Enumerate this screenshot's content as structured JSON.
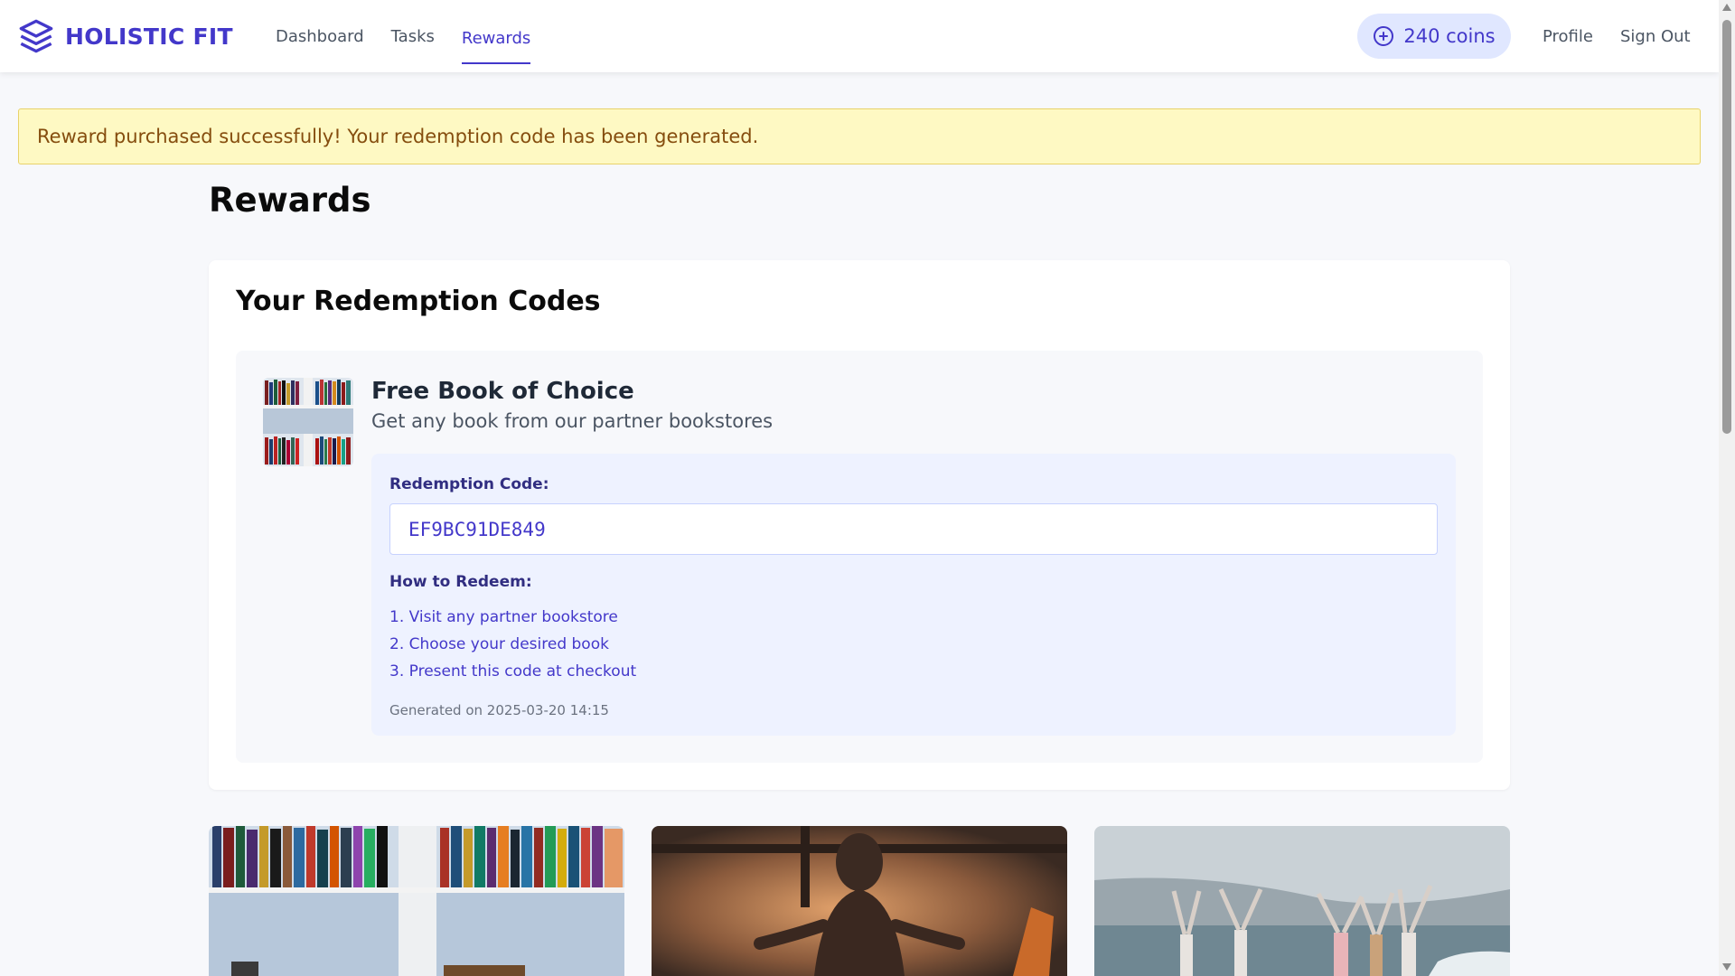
{
  "nav": {
    "brand": "HOLISTIC FIT",
    "links": [
      {
        "label": "Dashboard"
      },
      {
        "label": "Tasks"
      },
      {
        "label": "Rewards",
        "active": true
      }
    ],
    "coins": "240 coins",
    "profile": "Profile",
    "sign_out": "Sign Out"
  },
  "alert": {
    "message": "Reward purchased successfully! Your redemption code has been generated."
  },
  "page": {
    "title": "Rewards"
  },
  "codes": {
    "title": "Your Redemption Codes",
    "item": {
      "name": "Free Book of Choice",
      "description": "Get any book from our partner bookstores",
      "code_label": "Redemption Code:",
      "code": "EF9BC91DE849",
      "howto_label": "How to Redeem:",
      "steps": [
        "1. Visit any partner bookstore",
        "2. Choose your desired book",
        "3. Present this code at checkout"
      ],
      "generated": "Generated on 2025-03-20 14:15"
    }
  },
  "reward_cards": [
    {
      "image": "bookshelf-photo"
    },
    {
      "image": "meditation-photo"
    },
    {
      "image": "beach-yoga-photo"
    }
  ],
  "colors": {
    "accent": "#4338ca",
    "accent_light": "#e0e7ff",
    "alert_bg": "#fef9c3",
    "alert_text": "#854d0e"
  }
}
